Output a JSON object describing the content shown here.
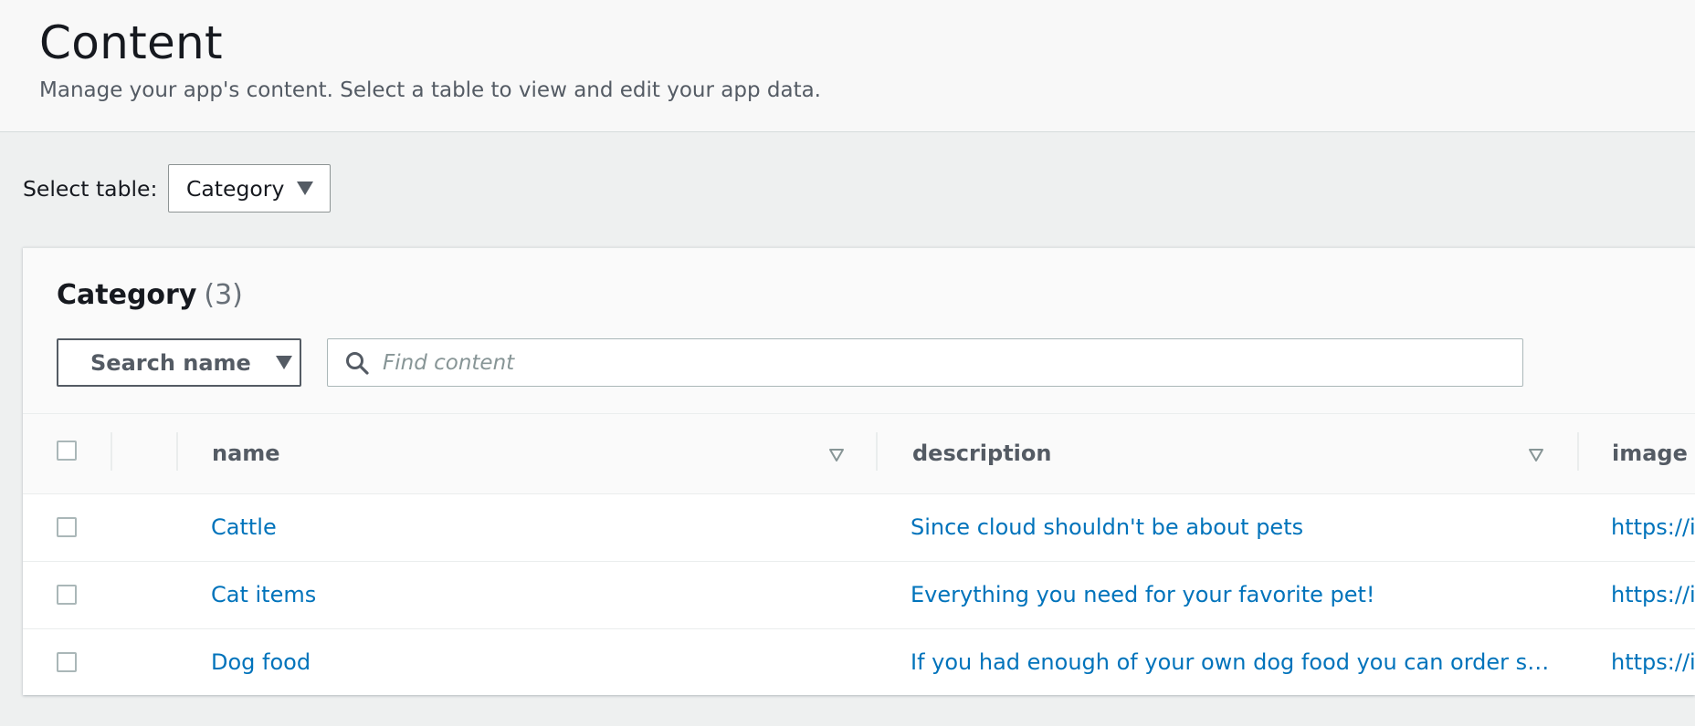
{
  "header": {
    "title": "Content",
    "description": "Manage your app's content. Select a table to view and edit your app data."
  },
  "table_selector": {
    "label": "Select table:",
    "value": "Category"
  },
  "card": {
    "title": "Category",
    "count": "(3)",
    "property_select": "Search name",
    "search_placeholder": "Find content"
  },
  "table": {
    "columns": [
      "name",
      "description",
      "image"
    ],
    "rows": [
      {
        "name": "Cattle",
        "description": "Since cloud shouldn't be about pets",
        "image": "https://i"
      },
      {
        "name": "Cat items",
        "description": "Everything you need for your favorite pet!",
        "image": "https://i"
      },
      {
        "name": "Dog food",
        "description": "If you had enough of your own dog food you can order so…",
        "image": "https://i"
      }
    ]
  },
  "icons": {
    "search": "search-icon",
    "dropdown": "caret-down-icon",
    "sort": "sort-down-icon"
  }
}
